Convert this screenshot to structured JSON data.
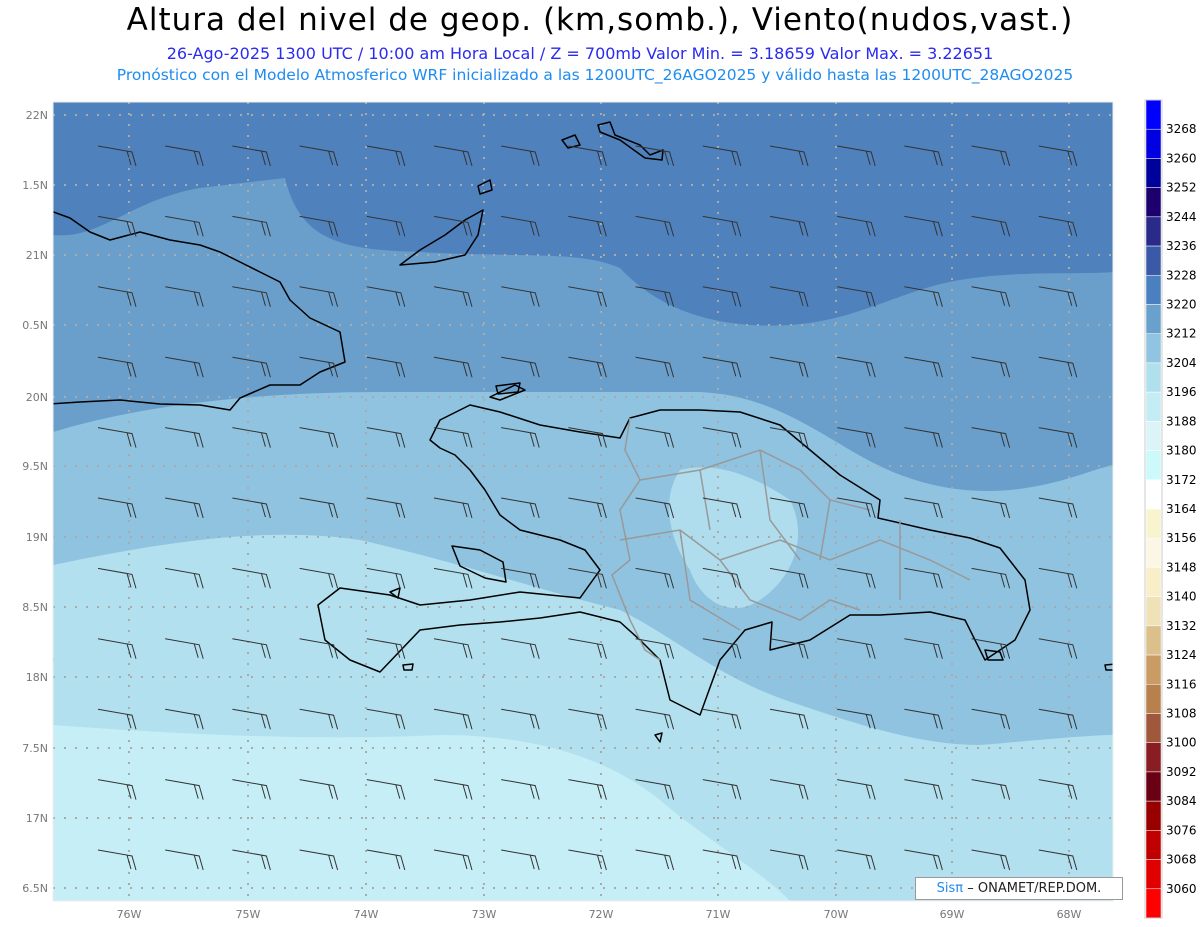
{
  "title": "Altura del nivel de geop. (km,somb.), Viento(nudos,vast.)",
  "subtitle": "26-Ago-2025  1300 UTC / 10:00 am Hora Local / Z = 700mb   Valor Min. = 3.18659  Valor Max. = 3.22651",
  "subtitle2": "Pronóstico con el Modelo Atmosferico WRF inicializado a las 1200UTC_26AGO2025 y válido hasta las  1200UTC_28AGO2025",
  "lat_labels": [
    "22N",
    "1.5N",
    "21N",
    "0.5N",
    "20N",
    "9.5N",
    "19N",
    "8.5N",
    "18N",
    "7.5N",
    "17N",
    "6.5N"
  ],
  "lon_labels": [
    "76W",
    "75W",
    "74W",
    "73W",
    "72W",
    "71W",
    "70W",
    "69W",
    "68W"
  ],
  "colorbar": {
    "labels": [
      "3268",
      "3260",
      "3252",
      "3244",
      "3236",
      "3228",
      "3220",
      "3212",
      "3204",
      "3196",
      "3188",
      "3180",
      "3172",
      "3164",
      "3156",
      "3148",
      "3140",
      "3132",
      "3124",
      "3116",
      "3108",
      "3100",
      "3092",
      "3084",
      "3076",
      "3068",
      "3060"
    ],
    "colors": [
      "#0000ff",
      "#0000e0",
      "#00009a",
      "#1c006e",
      "#2a2a8a",
      "#3a5aa8",
      "#4a80c0",
      "#6aa0cc",
      "#90c4e0",
      "#b0e0ec",
      "#c4ecf4",
      "#dcf4f8",
      "#ccfafa",
      "#ffffff",
      "#f8f4d0",
      "#fcf6e4",
      "#f8eec8",
      "#f0e2b8",
      "#dcc08c",
      "#c89c64",
      "#b8804c",
      "#a0583c",
      "#8a1c24",
      "#6a0014",
      "#980000",
      "#c00000",
      "#e00000",
      "#ff0000"
    ]
  },
  "bands": {
    "c3220": "#4f82bd",
    "c3212": "#6a9fcb",
    "c3204": "#8fc3e0",
    "c3196": "#b2e0ee",
    "c3188": "#c6eef6"
  },
  "credit": {
    "brand": "Sisπ",
    "text": "– ONAMET/REP.DOM."
  }
}
